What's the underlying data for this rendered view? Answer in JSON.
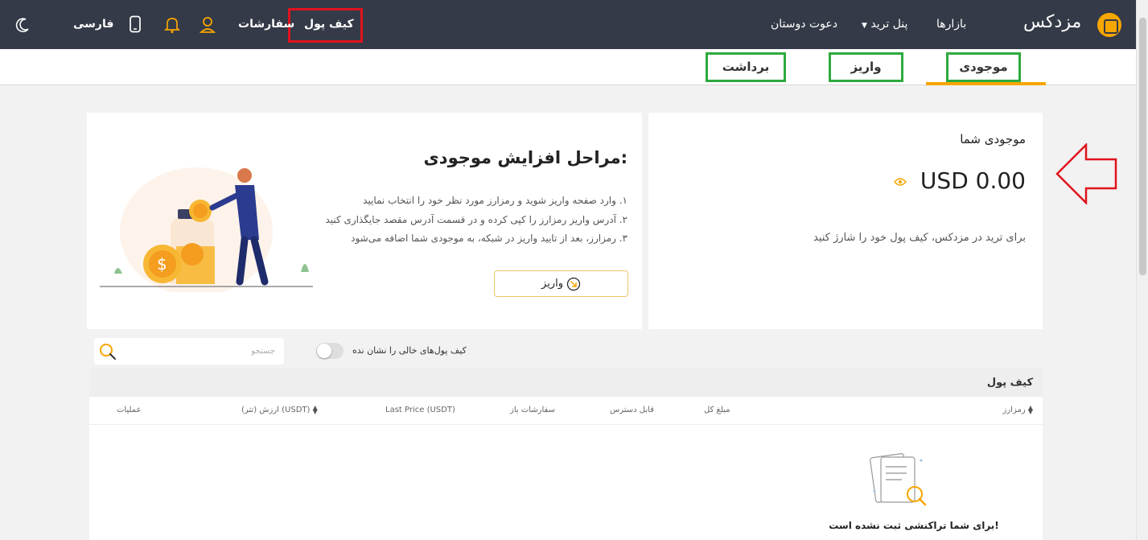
{
  "nav": {
    "logo_text": "مزدکس",
    "markets": "بازارها",
    "trade_panel": "پنل ترید",
    "invite": "دعوت دوستان",
    "wallet": "کیف پول",
    "orders": "سفارشات",
    "language": "فارسی"
  },
  "tabs": {
    "balance": "موجودی",
    "deposit": "واریز",
    "withdraw": "برداشت"
  },
  "balance_card": {
    "title": "موجودی شما",
    "amount": "USD 0.00",
    "hint": "برای ترید در مزدکس، کیف پول خود را شارژ کنید"
  },
  "steps_card": {
    "title": "مراحل افزایش موجودی:",
    "steps": [
      "۱. وارد صفحه واریز شوید و رمزارز مورد نظر خود را انتخاب نمایید",
      "۲. آدرس واریز رمزارز را کپی کرده و در قسمت آدرس مقصد جایگذاری کنید",
      "۳. رمزارز، بعد از تایید واریز در شبکه، به موجودی شما اضافه می‌شود"
    ],
    "button": "واریز"
  },
  "filter": {
    "hide_empty_label": "کیف پول‌های خالی را نشان نده",
    "search_placeholder": "جستجو"
  },
  "table": {
    "title": "کیف پول",
    "columns": {
      "currency": "رمزارز",
      "total": "مبلغ کل",
      "available": "قابل دسترس",
      "open_orders": "سفارشات باز",
      "last_price": "Last Price (USDT)",
      "value": "ارزش (تتر) (USDT)",
      "actions": "عملیات"
    },
    "empty_message": "برای شما تراکنشی ثبت نشده است!"
  },
  "colors": {
    "nav_bg": "#343a47",
    "accent": "#f7a600",
    "highlight_red": "#e0131d",
    "highlight_green": "#2eaa3e"
  }
}
